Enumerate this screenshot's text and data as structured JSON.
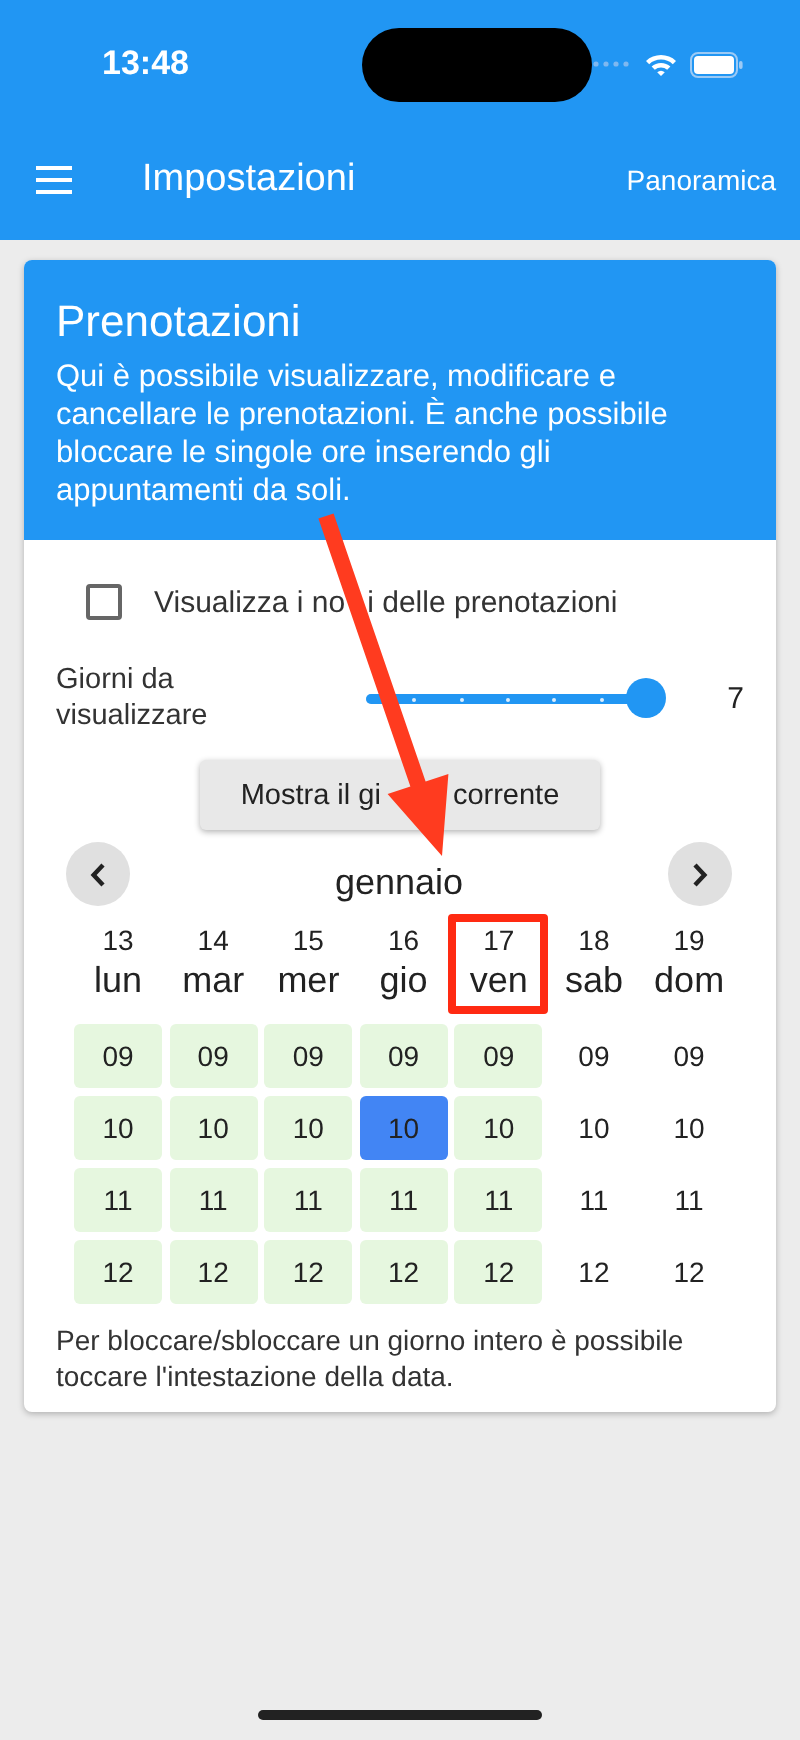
{
  "status_bar": {
    "time": "13:48"
  },
  "app_bar": {
    "title": "Impostazioni",
    "action": "Panoramica"
  },
  "card": {
    "title": "Prenotazioni",
    "description": "Qui è possibile visualizzare, modificare e cancellare le prenotazioni. È anche possibile bloccare le singole ore inserendo gli appuntamenti da soli."
  },
  "show_names": {
    "label_visible_parts": [
      "Visualizza i no",
      "i delle prenotazioni"
    ],
    "checked": false
  },
  "days_slider": {
    "label": "Giorni da visualizzare",
    "level": 1,
    "reading": "7"
  },
  "today_button": {
    "visible_parts": [
      "Mostra il gi",
      "corrente"
    ]
  },
  "month": "gennaio",
  "days": [
    {
      "number": "13",
      "name": "lun",
      "highlighted": false
    },
    {
      "number": "14",
      "name": "mar",
      "highlighted": false
    },
    {
      "number": "15",
      "name": "mer",
      "highlighted": false
    },
    {
      "number": "16",
      "name": "gio",
      "highlighted": false
    },
    {
      "number": "17",
      "name": "ven",
      "highlighted": true
    },
    {
      "number": "18",
      "name": "sab",
      "highlighted": false
    },
    {
      "number": "19",
      "name": "dom",
      "highlighted": false
    }
  ],
  "hours": [
    {
      "slots": [
        {
          "label": "09",
          "kind": "open"
        },
        {
          "label": "09",
          "kind": "open"
        },
        {
          "label": "09",
          "kind": "open"
        },
        {
          "label": "09",
          "kind": "open"
        },
        {
          "label": "09",
          "kind": "open"
        },
        {
          "label": "09",
          "kind": "closed"
        },
        {
          "label": "09",
          "kind": "closed"
        }
      ]
    },
    {
      "slots": [
        {
          "label": "10",
          "kind": "open"
        },
        {
          "label": "10",
          "kind": "open"
        },
        {
          "label": "10",
          "kind": "open"
        },
        {
          "label": "10",
          "kind": "booked"
        },
        {
          "label": "10",
          "kind": "open"
        },
        {
          "label": "10",
          "kind": "closed"
        },
        {
          "label": "10",
          "kind": "closed"
        }
      ]
    },
    {
      "slots": [
        {
          "label": "11",
          "kind": "open"
        },
        {
          "label": "11",
          "kind": "open"
        },
        {
          "label": "11",
          "kind": "open"
        },
        {
          "label": "11",
          "kind": "open"
        },
        {
          "label": "11",
          "kind": "open"
        },
        {
          "label": "11",
          "kind": "closed"
        },
        {
          "label": "11",
          "kind": "closed"
        }
      ]
    },
    {
      "slots": [
        {
          "label": "12",
          "kind": "open"
        },
        {
          "label": "12",
          "kind": "open"
        },
        {
          "label": "12",
          "kind": "open"
        },
        {
          "label": "12",
          "kind": "open"
        },
        {
          "label": "12",
          "kind": "open"
        },
        {
          "label": "12",
          "kind": "closed"
        },
        {
          "label": "12",
          "kind": "closed"
        }
      ]
    }
  ],
  "hint": "Per bloccare/sbloccare un giorno intero è possibile toccare l'intestazione della data."
}
